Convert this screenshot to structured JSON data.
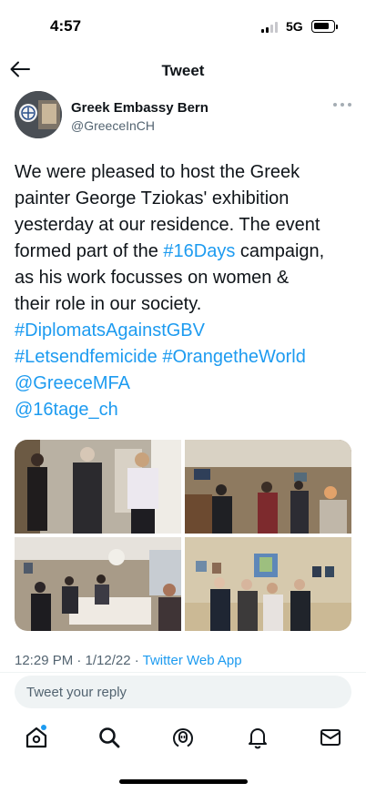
{
  "status_bar": {
    "time": "4:57",
    "network": "5G",
    "signal_bars": 4,
    "signal_bars_active": 2
  },
  "nav": {
    "title": "Tweet",
    "back_icon": "arrow-left-icon"
  },
  "tweet": {
    "author_name": "Greek Embassy Bern",
    "author_handle": "@GreeceInCH",
    "text_lines": [
      [
        {
          "t": "We were pleased to host the Greek",
          "link": false
        }
      ],
      [
        {
          "t": "painter George Tziokas' exhibition",
          "link": false
        }
      ],
      [
        {
          "t": "yesterday at our residence. The event",
          "link": false
        }
      ],
      [
        {
          "t": "formed part of the ",
          "link": false
        },
        {
          "t": "#16Days",
          "link": true
        },
        {
          "t": " campaign,",
          "link": false
        }
      ],
      [
        {
          "t": "as his work focusses on women &",
          "link": false
        }
      ],
      [
        {
          "t": "their role in our society.",
          "link": false
        }
      ],
      [
        {
          "t": "#DiplomatsAgainstGBV",
          "link": true
        }
      ],
      [
        {
          "t": "#Letsendfemicide",
          "link": true
        },
        {
          "t": " ",
          "link": false
        },
        {
          "t": "#OrangetheWorld",
          "link": true
        }
      ],
      [
        {
          "t": "@GreeceMFA",
          "link": true
        }
      ],
      [
        {
          "t": "@16tage_ch",
          "link": true
        }
      ]
    ],
    "photos_count": 4,
    "timestamp": "12:29 PM · 1/12/22 · ",
    "source": "Twitter Web App"
  },
  "reply": {
    "placeholder": "Tweet your reply"
  },
  "tabs": [
    {
      "name": "home",
      "icon": "home-icon",
      "has_notification_dot": true
    },
    {
      "name": "search",
      "icon": "search-icon"
    },
    {
      "name": "spaces",
      "icon": "spaces-icon"
    },
    {
      "name": "notifications",
      "icon": "bell-icon"
    },
    {
      "name": "messages",
      "icon": "mail-icon"
    }
  ],
  "colors": {
    "accent": "#1d9bf0",
    "text": "#0f1419",
    "secondary": "#536471",
    "reply_bg": "#eff3f4"
  }
}
